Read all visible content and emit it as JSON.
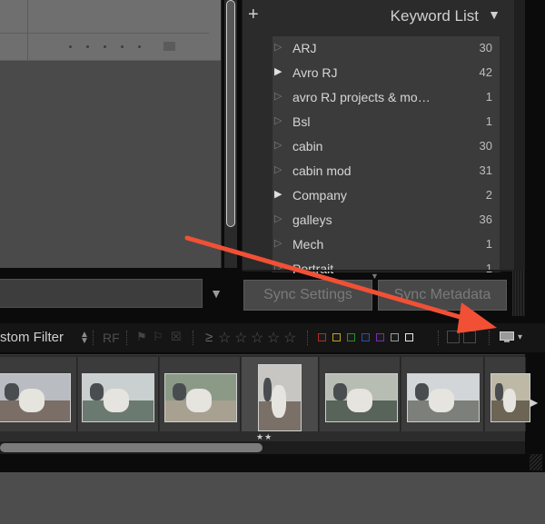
{
  "keyword_panel": {
    "add_label": "+",
    "title": "Keyword List",
    "collapse_glyph": "▼",
    "rows": [
      {
        "name": "ARJ",
        "count": "30",
        "expandable": false
      },
      {
        "name": "Avro RJ",
        "count": "42",
        "expandable": true
      },
      {
        "name": "avro RJ projects & mo…",
        "count": "1",
        "expandable": false
      },
      {
        "name": "Bsl",
        "count": "1",
        "expandable": false
      },
      {
        "name": "cabin",
        "count": "30",
        "expandable": false
      },
      {
        "name": "cabin mod",
        "count": "31",
        "expandable": false
      },
      {
        "name": "Company",
        "count": "2",
        "expandable": true
      },
      {
        "name": "galleys",
        "count": "36",
        "expandable": false
      },
      {
        "name": "Mech",
        "count": "1",
        "expandable": false
      },
      {
        "name": "Portrait",
        "count": "1",
        "expandable": false
      }
    ]
  },
  "sync": {
    "settings_label": "Sync Settings",
    "metadata_label": "Sync Metadata"
  },
  "filter_bar": {
    "preset_label": "stom Filter",
    "rf_label": "RF",
    "rating_op": "≥",
    "stars": "☆☆☆☆☆",
    "color_labels": [
      "#b32a2a",
      "#c2a21c",
      "#2e8a2e",
      "#2a4fb3",
      "#7a2ab3",
      "#9a9a9a",
      "#e8e8e8"
    ]
  },
  "filmstrip": {
    "selected_rating": "★★",
    "scroll_fraction": 0.5
  },
  "icons": {
    "next": "▶",
    "search_dropdown": "▼",
    "monitor_caret": "▾"
  }
}
